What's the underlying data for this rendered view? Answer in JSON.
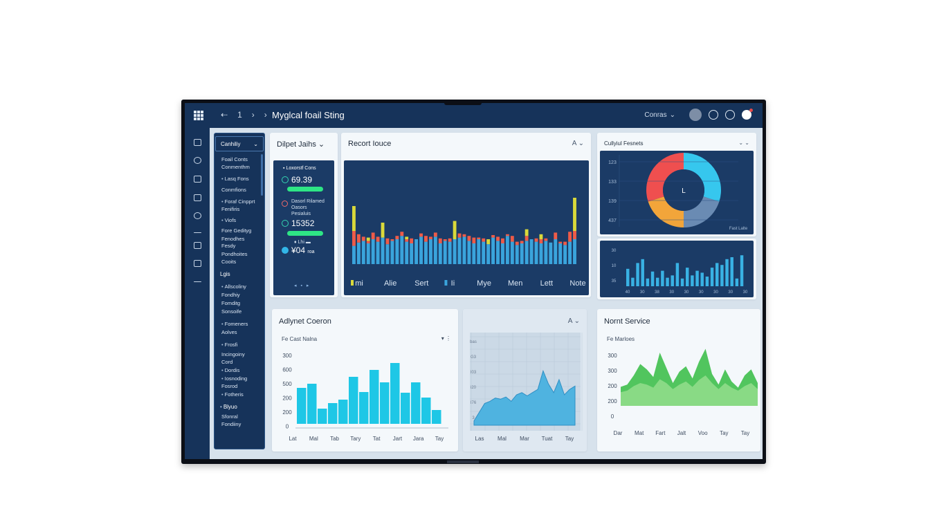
{
  "header": {
    "title": "Myglcal foail Sting",
    "nav_back": "⇠",
    "nav_num": "1",
    "nav_prev": "›",
    "nav_next": "›",
    "dropdown_label": "Conras",
    "dropdown_chevron": "⌄"
  },
  "sidebar": {
    "head_label": "Canhiliy",
    "head_chevron": "⌄",
    "items": [
      {
        "label": "Foail Conts",
        "bullet": false
      },
      {
        "label": "Conmenthm",
        "bullet": false
      },
      {
        "label": "Lasq Fons",
        "bullet": true
      },
      {
        "label": "Conmfions",
        "bullet": false
      },
      {
        "label": "Foraf Cinpprt",
        "bullet": true
      },
      {
        "label": "Fenifiris",
        "bullet": false
      },
      {
        "label": "Viofs",
        "bullet": true
      },
      {
        "label": "Fore Gedityg",
        "bullet": false
      },
      {
        "label": "Fenodhes",
        "bullet": false
      },
      {
        "label": "Fesdy",
        "bullet": false
      },
      {
        "label": "Pondhoites",
        "bullet": false
      },
      {
        "label": "Cooits",
        "bullet": false
      },
      {
        "label": "Lgis",
        "bullet": false,
        "section": true
      },
      {
        "label": "Allscoliny",
        "bullet": true
      },
      {
        "label": "Fondhiy",
        "bullet": false
      },
      {
        "label": "Fomditg",
        "bullet": false
      },
      {
        "label": "Sonsoife",
        "bullet": false
      },
      {
        "label": "Fomeners",
        "bullet": true
      },
      {
        "label": "Aolves",
        "bullet": false
      },
      {
        "label": "Frosfi",
        "bullet": true
      },
      {
        "label": "Incingoiny",
        "bullet": false
      },
      {
        "label": "Cord",
        "bullet": false
      },
      {
        "label": "Dordis",
        "bullet": true
      },
      {
        "label": "Iosnoding",
        "bullet": true
      },
      {
        "label": "Fosrod",
        "bullet": false
      },
      {
        "label": "Fotheris",
        "bullet": true
      },
      {
        "label": "Blyuo",
        "bullet": true,
        "section": true
      },
      {
        "label": "Sfonral",
        "bullet": false
      },
      {
        "label": "Fondiiny",
        "bullet": false
      }
    ]
  },
  "summary": {
    "title": "Dilpet Jaihs",
    "chevron": "⌄",
    "list_header": "Loxorstf Cons",
    "metric1": "69.39",
    "desc2a": "Dasorl Rilamed",
    "desc2b": "Oasors",
    "desc2c": "Pesialuis",
    "metric2": "15352",
    "metric3_top": "Lhi",
    "metric3": "¥04",
    "metric3_unit": "roa",
    "pager": "◂ ▪ ▸"
  },
  "report": {
    "title": "Recort Iouce",
    "chevron": "A ⌄",
    "chart_data": {
      "type": "bar",
      "stacked": true,
      "categories": [
        "",
        "",
        "",
        "",
        "",
        "",
        "",
        "",
        "",
        "",
        "",
        "",
        "",
        "",
        "",
        "",
        "",
        "",
        "",
        "",
        "",
        "",
        "",
        "",
        "",
        "",
        "",
        "",
        "",
        "",
        "",
        "",
        "",
        "",
        "",
        "",
        "",
        "",
        "",
        "",
        "",
        "",
        "",
        "",
        "",
        "",
        ""
      ],
      "series": [
        {
          "color": "#3aa4dc",
          "values": [
            22,
            26,
            28,
            25,
            30,
            27,
            32,
            24,
            28,
            30,
            34,
            27,
            25,
            30,
            33,
            27,
            30,
            33,
            25,
            28,
            27,
            30,
            32,
            33,
            28,
            25,
            30,
            27,
            24,
            32,
            28,
            25,
            34,
            27,
            23,
            25,
            28,
            30,
            27,
            25,
            28,
            26,
            30,
            25,
            23,
            27,
            30
          ]
        },
        {
          "color": "#ee5b48",
          "values": [
            18,
            10,
            5,
            3,
            8,
            6,
            0,
            7,
            2,
            4,
            5,
            3,
            6,
            0,
            4,
            7,
            3,
            5,
            6,
            2,
            4,
            0,
            5,
            3,
            6,
            7,
            2,
            4,
            0,
            3,
            5,
            6,
            2,
            7,
            4,
            3,
            6,
            0,
            4,
            5,
            3,
            0,
            8,
            2,
            4,
            12,
            10
          ]
        },
        {
          "color": "#d9d93a",
          "values": [
            30,
            0,
            0,
            4,
            0,
            0,
            18,
            0,
            0,
            0,
            0,
            3,
            0,
            0,
            0,
            0,
            0,
            0,
            0,
            0,
            0,
            22,
            0,
            0,
            0,
            0,
            0,
            0,
            6,
            0,
            0,
            0,
            0,
            0,
            0,
            0,
            8,
            0,
            0,
            6,
            0,
            0,
            0,
            0,
            0,
            0,
            40
          ]
        }
      ],
      "xticks": [
        {
          "label": "mi",
          "color": "#d9d93a"
        },
        {
          "label": "Alie"
        },
        {
          "label": "Sert"
        },
        {
          "label": "Ii",
          "color": "#3aa4dc"
        },
        {
          "label": "Mye"
        },
        {
          "label": "Men"
        },
        {
          "label": "Lett"
        },
        {
          "label": "Note"
        }
      ],
      "ylim": [
        0,
        100
      ]
    }
  },
  "donut": {
    "title": "Cullyiul Fesnets",
    "chevron": "⌄ ⌄",
    "center_label": "L",
    "footnote": "Fast Lalte",
    "yticks": [
      "123",
      "133",
      "139",
      "437"
    ],
    "chart_data": {
      "type": "pie",
      "segments": [
        {
          "value": 30,
          "color": "#36c7ee"
        },
        {
          "value": 20,
          "color": "#6a8bb3"
        },
        {
          "value": 20,
          "color": "#f2a53a"
        },
        {
          "value": 30,
          "color": "#ef4f4f"
        }
      ]
    }
  },
  "mini_bars": {
    "yticks": [
      "30",
      "10",
      "35"
    ],
    "xticks": [
      "40",
      "30",
      "38",
      "30",
      "30",
      "30",
      "30",
      "30",
      "30"
    ],
    "chart_data": {
      "type": "bar",
      "values": [
        45,
        22,
        60,
        70,
        20,
        38,
        22,
        40,
        22,
        28,
        60,
        20,
        48,
        28,
        40,
        35,
        25,
        48,
        60,
        55,
        70,
        75,
        20,
        80
      ]
    }
  },
  "adjust": {
    "title": "Adlynet Coeron",
    "subtitle": "Fe Cast Nalna",
    "icons": "▾ ⋮",
    "yticks": [
      "300",
      "600",
      "500",
      "200",
      "200",
      "0"
    ],
    "xticks": [
      "Lat",
      "Mal",
      "Tab",
      "Tary",
      "Tat",
      "Jart",
      "Jara",
      "Tay"
    ],
    "chart_data": {
      "type": "bar",
      "values": [
        52,
        58,
        22,
        30,
        35,
        68,
        46,
        78,
        60,
        88,
        45,
        60,
        38,
        20
      ],
      "ylim": [
        0,
        100
      ]
    }
  },
  "area_mid": {
    "chevron": "A ⌄",
    "yticks": [
      "bas",
      "G3",
      "I03",
      "i20",
      "I76",
      "3"
    ],
    "xticks": [
      "Las",
      "Mal",
      "Mar",
      "Tuat",
      "Tay"
    ],
    "chart_data": {
      "type": "area",
      "values": [
        4,
        12,
        20,
        22,
        25,
        24,
        26,
        22,
        28,
        30,
        27,
        30,
        33,
        50,
        38,
        30,
        42,
        28,
        33,
        36
      ],
      "ylim": [
        0,
        70
      ]
    }
  },
  "normal": {
    "title": "Nornt Service",
    "subtitle": "Fe Marloes",
    "yticks": [
      "300",
      "300",
      "200",
      "200",
      "0"
    ],
    "xticks": [
      "Dar",
      "Mat",
      "Fart",
      "Jalt",
      "Voo",
      "Tay",
      "Tay"
    ],
    "chart_data": {
      "type": "area",
      "series": [
        {
          "color": "#3fbf4d",
          "values": [
            25,
            28,
            40,
            55,
            48,
            38,
            70,
            50,
            30,
            45,
            52,
            36,
            58,
            75,
            42,
            28,
            48,
            32,
            24,
            40,
            48,
            30
          ]
        },
        {
          "color": "#8fdc8a",
          "values": [
            18,
            20,
            26,
            30,
            28,
            24,
            35,
            30,
            22,
            28,
            32,
            25,
            34,
            40,
            30,
            22,
            30,
            24,
            20,
            26,
            30,
            22
          ]
        }
      ],
      "ylim": [
        0,
        100
      ]
    }
  }
}
